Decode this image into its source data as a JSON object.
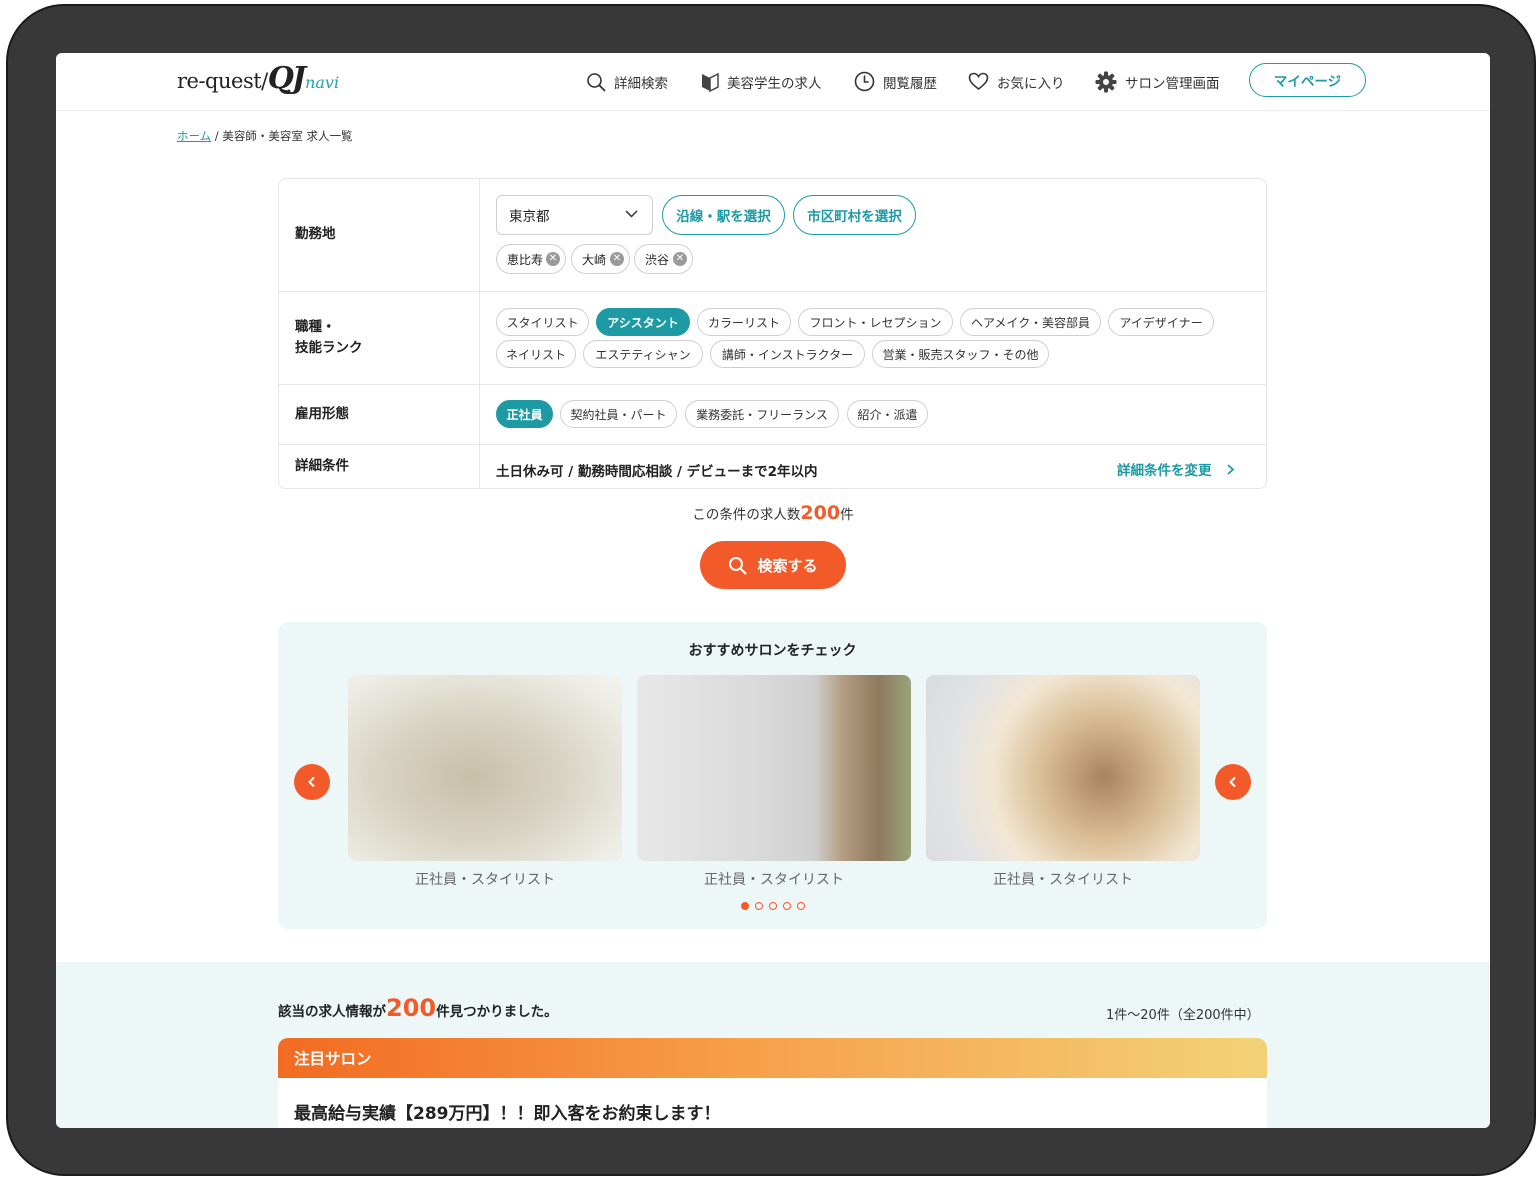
{
  "header": {
    "logo_main": "re-quest/",
    "logo_qj": "QJ",
    "logo_navi": "navi",
    "nav": {
      "search": "詳細検索",
      "students": "美容学生の求人",
      "history": "閲覧履歴",
      "favorites": "お気に入り",
      "salon_admin": "サロン管理画面"
    },
    "mypage": "マイページ"
  },
  "breadcrumb": {
    "home": "ホーム",
    "separator": " / ",
    "current": "美容師・美容室 求人一覧"
  },
  "search": {
    "location": {
      "label": "勤務地",
      "prefecture": "東京都",
      "line_button": "沿線・駅を選択",
      "city_button": "市区町村を選択",
      "selected": [
        "恵比寿",
        "大崎",
        "渋谷"
      ]
    },
    "job": {
      "label_line1": "職種・",
      "label_line2": "技能ランク",
      "options": [
        "スタイリスト",
        "アシスタント",
        "カラーリスト",
        "フロント・レセプション",
        "ヘアメイク・美容部員",
        "アイデザイナー",
        "ネイリスト",
        "エステティシャン",
        "講師・インストラクター",
        "営業・販売スタッフ・その他"
      ],
      "selected": "アシスタント"
    },
    "employment": {
      "label": "雇用形態",
      "options": [
        "正社員",
        "契約社員・パート",
        "業務委託・フリーランス",
        "紹介・派遣"
      ],
      "selected": "正社員"
    },
    "details": {
      "label": "詳細条件",
      "value": "土日休み可 / 勤務時間応相談 / デビューまで2年以内",
      "change_link": "詳細条件を変更"
    },
    "count_prefix": "この条件の求人数",
    "count": "200",
    "count_suffix": "件",
    "search_button": "検索する"
  },
  "recommend": {
    "title": "おすすめサロンをチェック",
    "cards": [
      {
        "caption": "正社員・スタイリスト"
      },
      {
        "caption": "正社員・スタイリスト"
      },
      {
        "caption": "正社員・スタイリスト"
      }
    ],
    "pages": 5,
    "current_page": 1
  },
  "results": {
    "found_prefix": "該当の求人情報が",
    "found_count": "200",
    "found_suffix": "件見つかりました。",
    "range": "1件〜20件（全200件中）",
    "featured_label": "注目サロン",
    "featured_title": "最高給与実績【289万円】！！即入客をお約束します！"
  },
  "colors": {
    "accent_teal": "#1e9aa5",
    "accent_orange": "#f25a2a"
  }
}
